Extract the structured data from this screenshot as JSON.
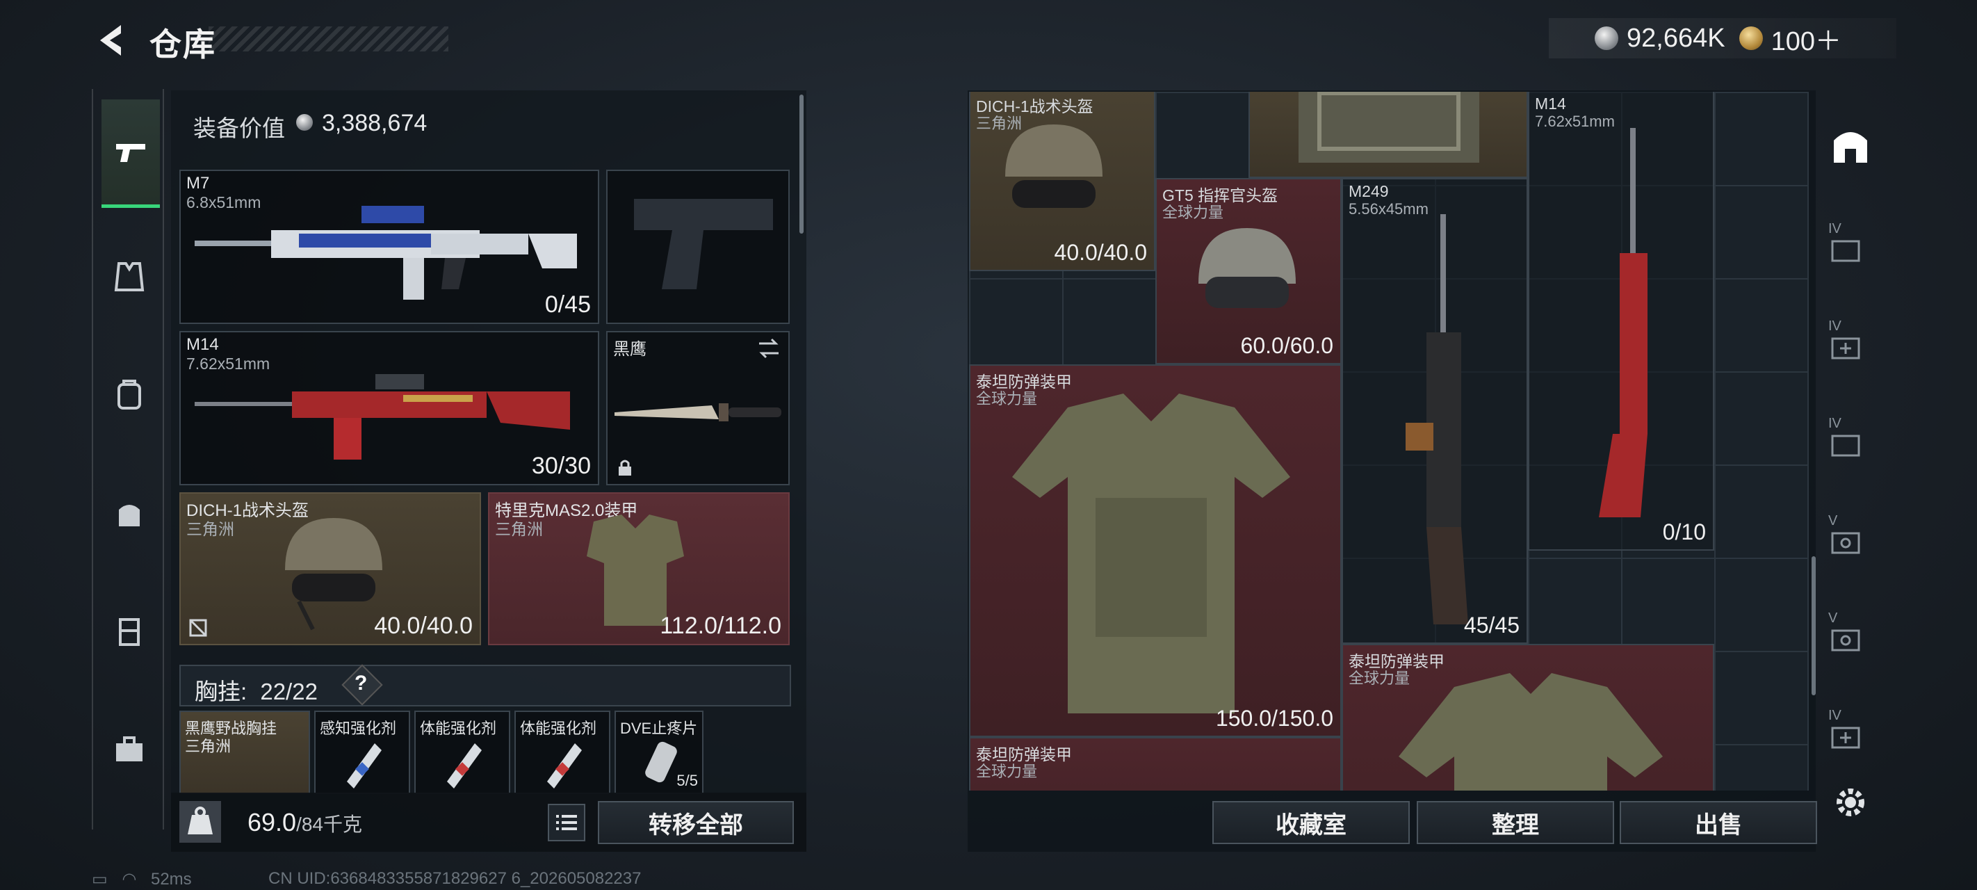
{
  "header": {
    "title": "仓库",
    "currency": [
      {
        "icon": "silver-coin-icon",
        "value": "92,664K"
      },
      {
        "icon": "gold-coin-icon",
        "value": "100＋"
      }
    ]
  },
  "left_panel": {
    "value_label": "装备价值",
    "value": "3,388,674",
    "slots": {
      "primary1": {
        "name": "M7",
        "caliber": "6.8x51mm",
        "count": "0/45"
      },
      "pistol": {
        "icon": "pistol-silhouette-icon"
      },
      "primary2": {
        "name": "M14",
        "caliber": "7.62x51mm",
        "count": "30/30"
      },
      "melee": {
        "name": "黑鹰"
      },
      "helmet": {
        "name": "DICH-1战术头盔",
        "source": "三角洲",
        "durability": "40.0/40.0"
      },
      "armor": {
        "name": "特里克MAS2.0装甲",
        "source": "三角洲",
        "durability": "112.0/112.0"
      }
    },
    "chest_rig": {
      "label": "胸挂:",
      "capacity": "22/22",
      "help": "?",
      "items": [
        {
          "name": "黑鹰野战胸挂",
          "sub": "三角洲"
        },
        {
          "name": "感知强化剂"
        },
        {
          "name": "体能强化剂"
        },
        {
          "name": "体能强化剂"
        },
        {
          "name": "DVE止疼片",
          "count": "5/5"
        }
      ]
    },
    "weight": "69.0",
    "weight_max": "/84千克",
    "transfer_all": "转移全部"
  },
  "stash": {
    "items": [
      {
        "name": "DICH-1战术头盔",
        "sub": "三角洲",
        "count": "40.0/40.0"
      },
      {
        "name": "GT5 指挥官头盔",
        "sub": "全球力量",
        "count": "60.0/60.0"
      },
      {
        "name": "M14",
        "sub": "7.62x51mm",
        "count": "0/10"
      },
      {
        "name": "M249",
        "sub": "5.56x45mm",
        "count": "45/45"
      },
      {
        "name": "泰坦防弹装甲",
        "sub": "全球力量",
        "count": "150.0/150.0"
      },
      {
        "name": "泰坦防弹装甲",
        "sub": "全球力量"
      },
      {
        "name": "泰坦防弹装甲",
        "sub": "全球力量"
      }
    ],
    "buttons": {
      "collection": "收藏室",
      "sort": "整理",
      "sell": "出售"
    },
    "side_tabs": [
      "IV",
      "IV",
      "IV",
      "V",
      "V",
      "IV"
    ]
  },
  "status": {
    "ping": "52ms",
    "uid": "CN UID:6368483355871829627 6_202605082237"
  },
  "colors": {
    "accent_green": "#38d67a",
    "helmet_bg": "#4a4232",
    "armor_bg": "#5a2e34"
  }
}
